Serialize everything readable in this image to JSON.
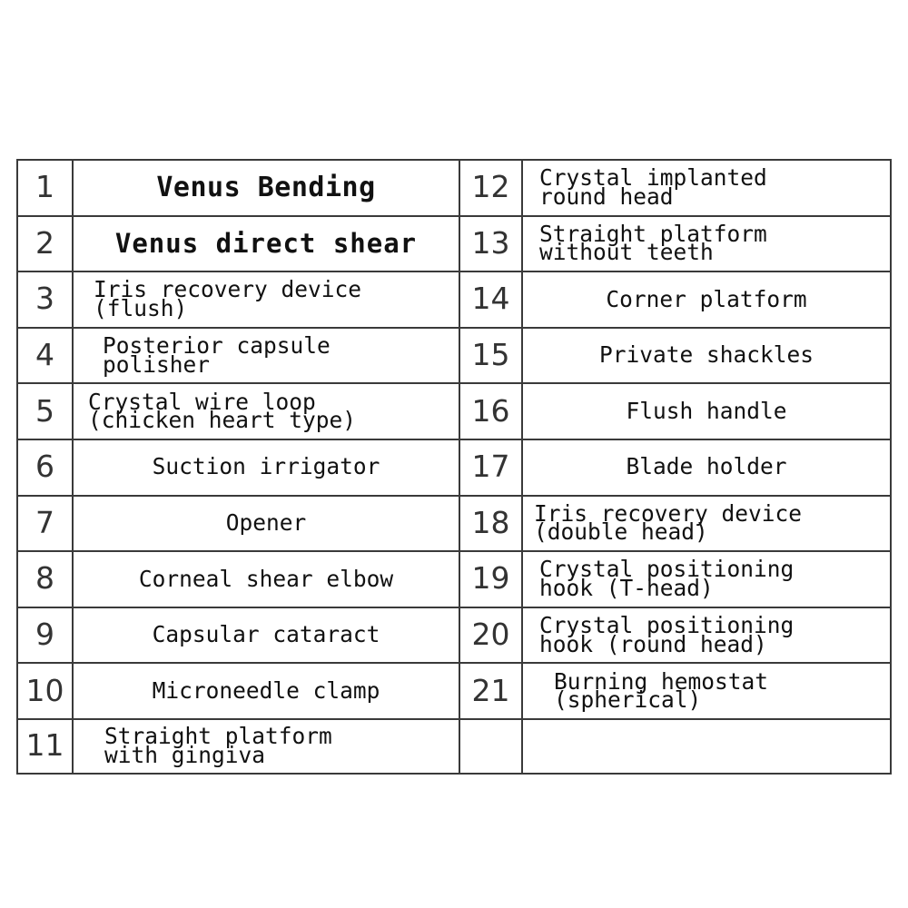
{
  "document": {
    "kind": "instrument-parts-list-table",
    "background_color": "#ffffff",
    "border_color": "#3a3a3a",
    "number_color": "#333333",
    "label_color": "#111111"
  },
  "table": {
    "columns": 2,
    "rows_per_column": 11,
    "left": [
      {
        "number": "1",
        "label": "Venus Bending",
        "lines": 1,
        "emphasis": "big"
      },
      {
        "number": "2",
        "label": "Venus direct shear",
        "lines": 1,
        "emphasis": "big2"
      },
      {
        "number": "3",
        "label": "Iris recovery device\n(flush)",
        "lines": 2,
        "emphasis": "none"
      },
      {
        "number": "4",
        "label": "Posterior capsule\npolisher",
        "lines": 2,
        "emphasis": "none"
      },
      {
        "number": "5",
        "label": "Crystal wire loop\n(chicken heart type)",
        "lines": 2,
        "emphasis": "none"
      },
      {
        "number": "6",
        "label": "Suction irrigator",
        "lines": 1,
        "emphasis": "none"
      },
      {
        "number": "7",
        "label": "Opener",
        "lines": 1,
        "emphasis": "none"
      },
      {
        "number": "8",
        "label": "Corneal shear elbow",
        "lines": 1,
        "emphasis": "none"
      },
      {
        "number": "9",
        "label": "Capsular cataract",
        "lines": 1,
        "emphasis": "none"
      },
      {
        "number": "10",
        "label": "Microneedle clamp",
        "lines": 1,
        "emphasis": "none"
      },
      {
        "number": "11",
        "label": "Straight platform\nwith gingiva",
        "lines": 2,
        "emphasis": "none"
      }
    ],
    "right": [
      {
        "number": "12",
        "label": "Crystal implanted\nround head",
        "lines": 2,
        "emphasis": "none"
      },
      {
        "number": "13",
        "label": "Straight platform\nwithout teeth",
        "lines": 2,
        "emphasis": "none"
      },
      {
        "number": "14",
        "label": "Corner platform",
        "lines": 1,
        "emphasis": "none"
      },
      {
        "number": "15",
        "label": "Private shackles",
        "lines": 1,
        "emphasis": "none"
      },
      {
        "number": "16",
        "label": "Flush handle",
        "lines": 1,
        "emphasis": "none"
      },
      {
        "number": "17",
        "label": "Blade holder",
        "lines": 1,
        "emphasis": "none"
      },
      {
        "number": "18",
        "label": "Iris recovery device\n(double head)",
        "lines": 2,
        "emphasis": "none"
      },
      {
        "number": "19",
        "label": "Crystal positioning\nhook (T-head)",
        "lines": 2,
        "emphasis": "none"
      },
      {
        "number": "20",
        "label": "Crystal positioning\nhook (round head)",
        "lines": 2,
        "emphasis": "none"
      },
      {
        "number": "21",
        "label": "Burning hemostat\n(spherical)",
        "lines": 2,
        "emphasis": "none"
      },
      {
        "number": "",
        "label": "",
        "lines": 0,
        "emphasis": "none"
      }
    ]
  }
}
